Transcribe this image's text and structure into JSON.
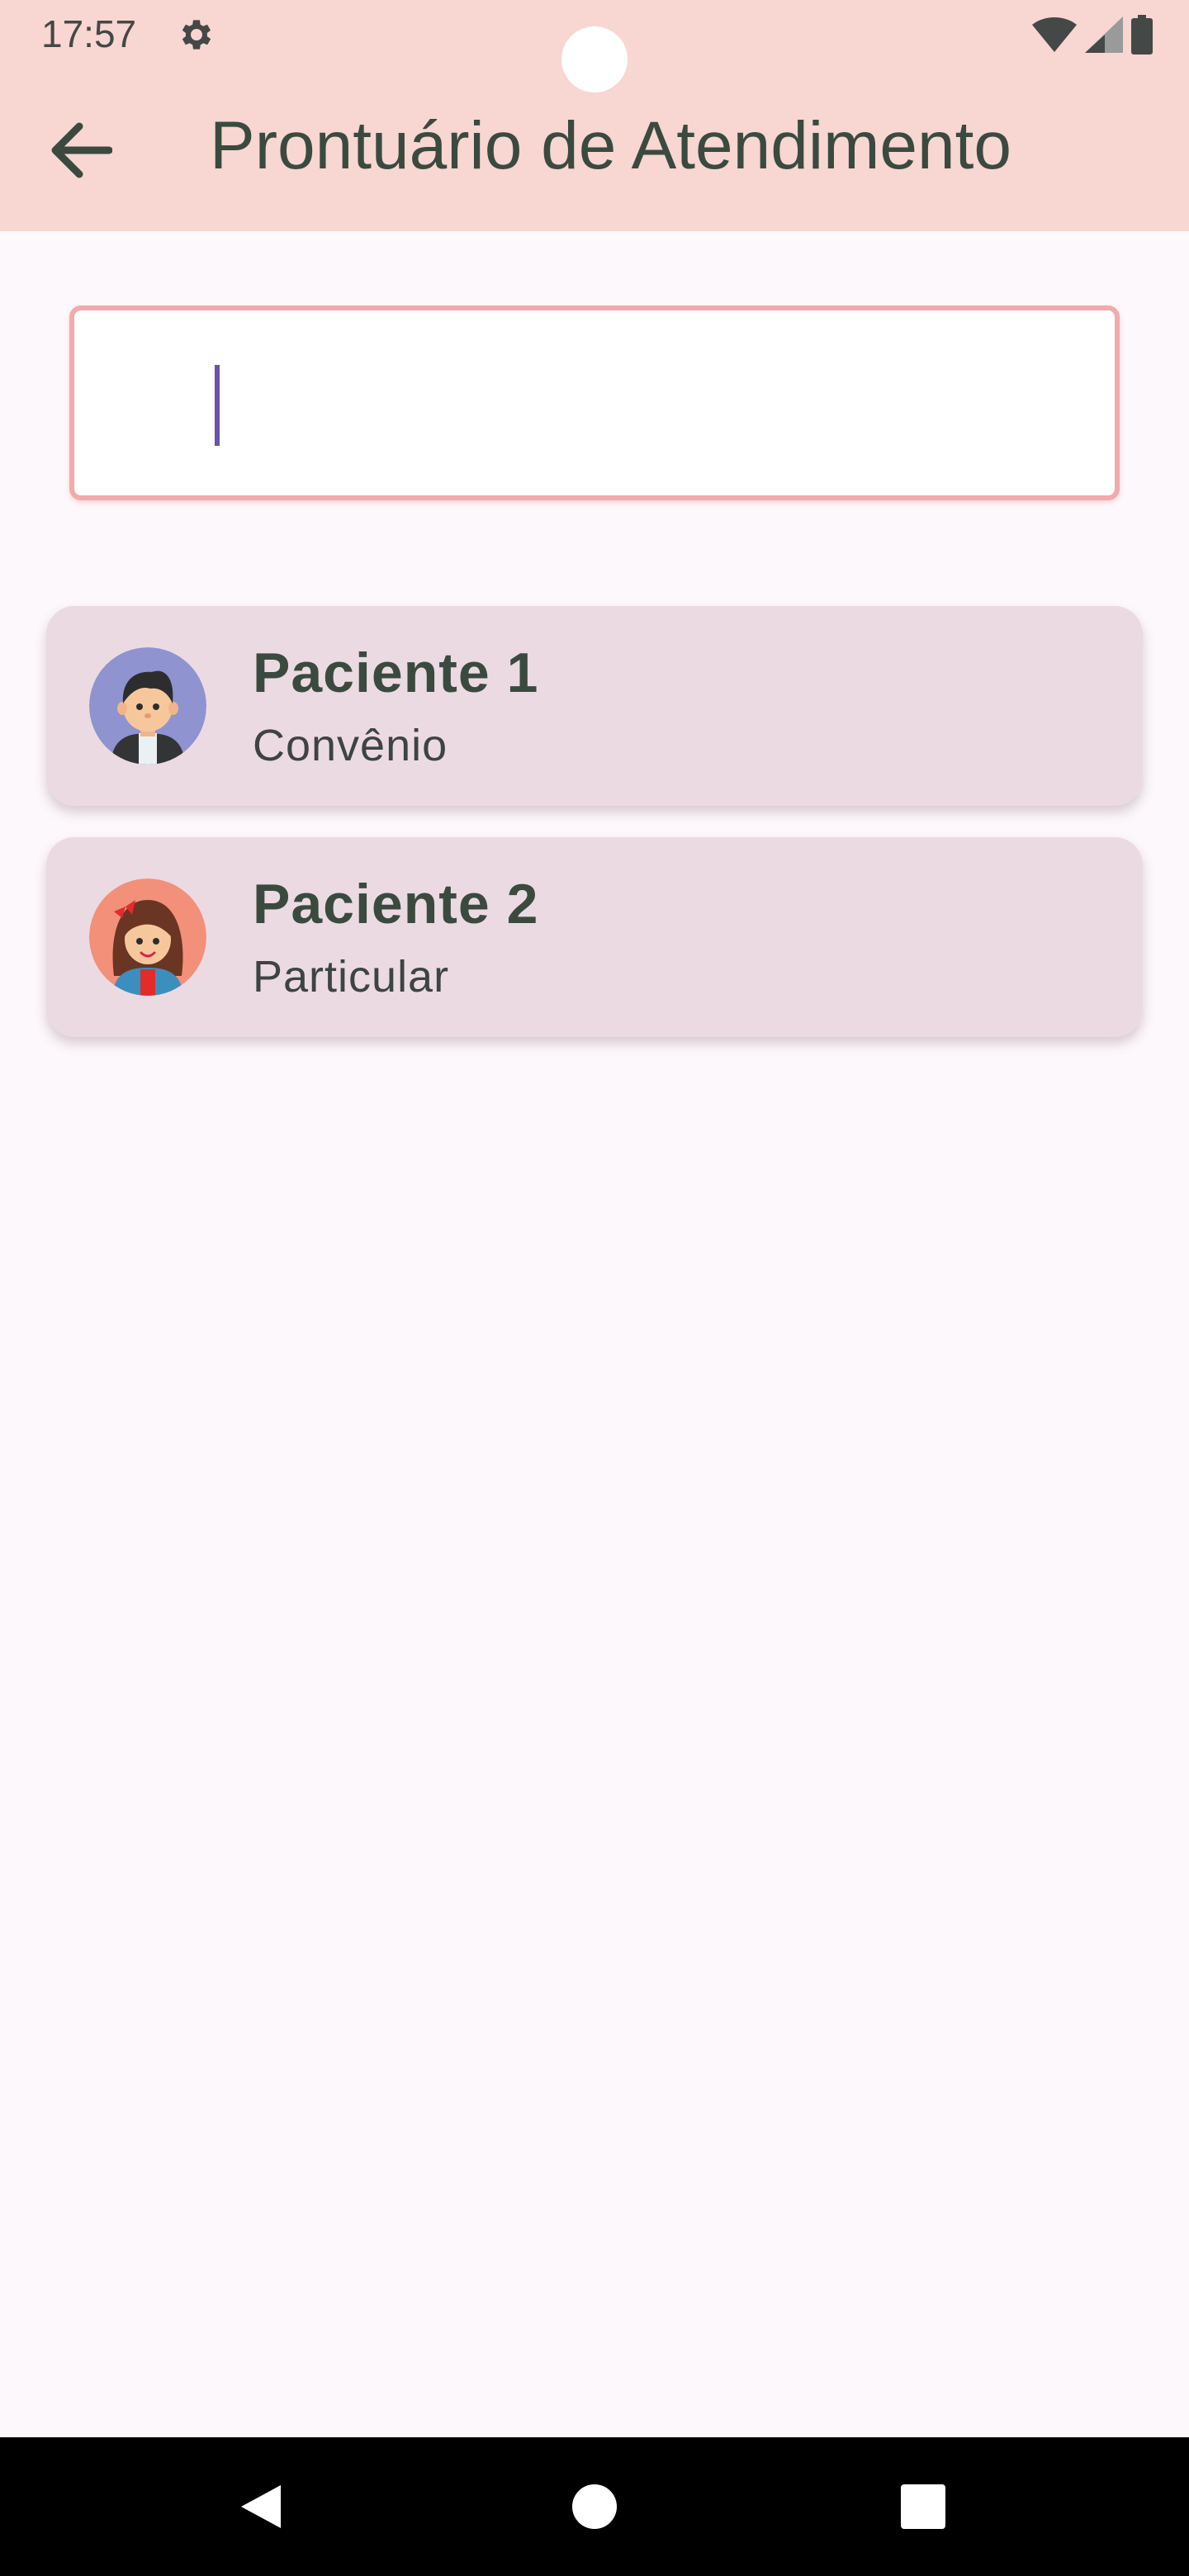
{
  "status_bar": {
    "time": "17:57",
    "icons": [
      "gear-icon",
      "wifi-icon",
      "signal-icon",
      "battery-icon"
    ]
  },
  "app_bar": {
    "title": "Prontuário de Atendimento",
    "back_icon": "arrow-back-icon"
  },
  "search": {
    "value": "",
    "placeholder": ""
  },
  "patients": [
    {
      "name": "Paciente 1",
      "type": "Convênio",
      "avatar": "boy-avatar-icon"
    },
    {
      "name": "Paciente 2",
      "type": "Particular",
      "avatar": "girl-avatar-icon"
    }
  ],
  "nav_bar": {
    "icons": [
      "nav-back-icon",
      "nav-home-icon",
      "nav-recents-icon"
    ]
  },
  "colors": {
    "app_bar": "#f8d6d2",
    "background": "#fdf8fb",
    "card": "#ecdae3",
    "search_border": "#f2aaaa",
    "caret": "#6a53a8",
    "text": "#3a4a3f"
  }
}
